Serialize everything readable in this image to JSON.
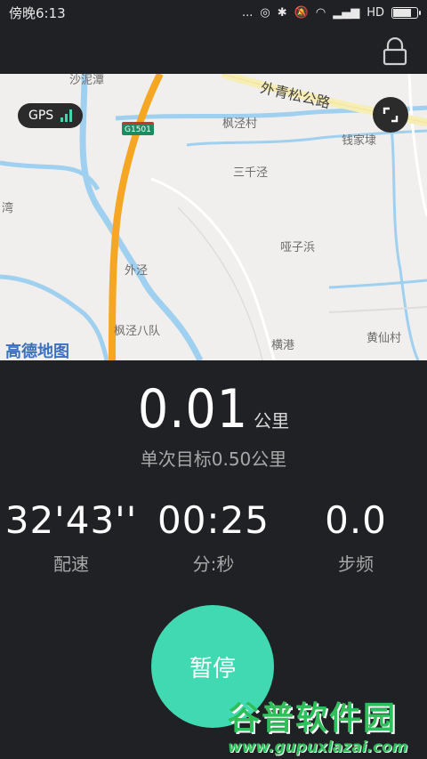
{
  "status_bar": {
    "time": "傍晚6:13",
    "dots": "...",
    "network": "HD",
    "battery_level": 0.85
  },
  "map": {
    "gps_label": "GPS",
    "road_name": "外青松公路",
    "highway_code": "G1501",
    "places": [
      "沙泥潭",
      "枫泾村",
      "钱家埭",
      "三千泾",
      "湾",
      "哑子浜",
      "外泾",
      "枫泾八队",
      "横港",
      "黄仙村"
    ],
    "map_logo": "高德地图"
  },
  "run": {
    "distance": "0.01",
    "distance_unit": "公里",
    "goal": "单次目标0.50公里"
  },
  "stats": [
    {
      "value": "32'43''",
      "label": "配速"
    },
    {
      "value": "00:25",
      "label": "分:秒"
    },
    {
      "value": "0.0",
      "label": "步频"
    }
  ],
  "controls": {
    "pause_label": "暂停"
  },
  "watermark": {
    "title": "谷普软件园",
    "url": "www.gupuxlazai.com"
  },
  "colors": {
    "accent": "#40d9b2",
    "background": "#202124",
    "highway": "#f5a623",
    "water": "#9fd0ef"
  }
}
